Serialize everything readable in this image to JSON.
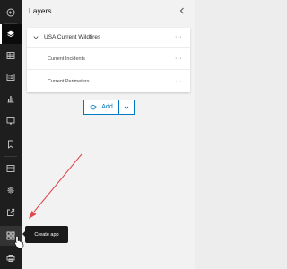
{
  "toolbar": {
    "items": [
      {
        "name": "back",
        "icon": "circle-arrow-left-icon"
      },
      {
        "name": "layers",
        "icon": "layers-icon",
        "active": true
      },
      {
        "name": "tables",
        "icon": "table-icon"
      },
      {
        "name": "legend",
        "icon": "legend-list-icon"
      },
      {
        "name": "charts",
        "icon": "bar-chart-icon"
      },
      {
        "name": "pop-ups",
        "icon": "popup-window-icon"
      },
      {
        "name": "bookmarks",
        "icon": "bookmark-icon"
      },
      {
        "name": "media",
        "icon": "image-icon"
      },
      {
        "name": "settings",
        "icon": "gear-icon"
      },
      {
        "name": "share",
        "icon": "share-icon"
      },
      {
        "name": "create-app",
        "icon": "grid-apps-icon",
        "hover": true
      },
      {
        "name": "print",
        "icon": "print-icon"
      }
    ]
  },
  "panel": {
    "title": "Layers",
    "group_layer": {
      "label": "USA Current Wildfires",
      "expanded": true,
      "children": [
        {
          "label": "Current Incidents"
        },
        {
          "label": "Current Perimeters"
        }
      ]
    },
    "more_label": "···",
    "add_button_label": "Add"
  },
  "tooltip": {
    "text": "Create app"
  },
  "colors": {
    "toolbar_bg": "#1e1e1e",
    "panel_bg": "#f2f2f2",
    "accent": "#0079c1",
    "annotation_arrow": "#e0474c",
    "tooltip_bg": "#1a1a1a"
  }
}
